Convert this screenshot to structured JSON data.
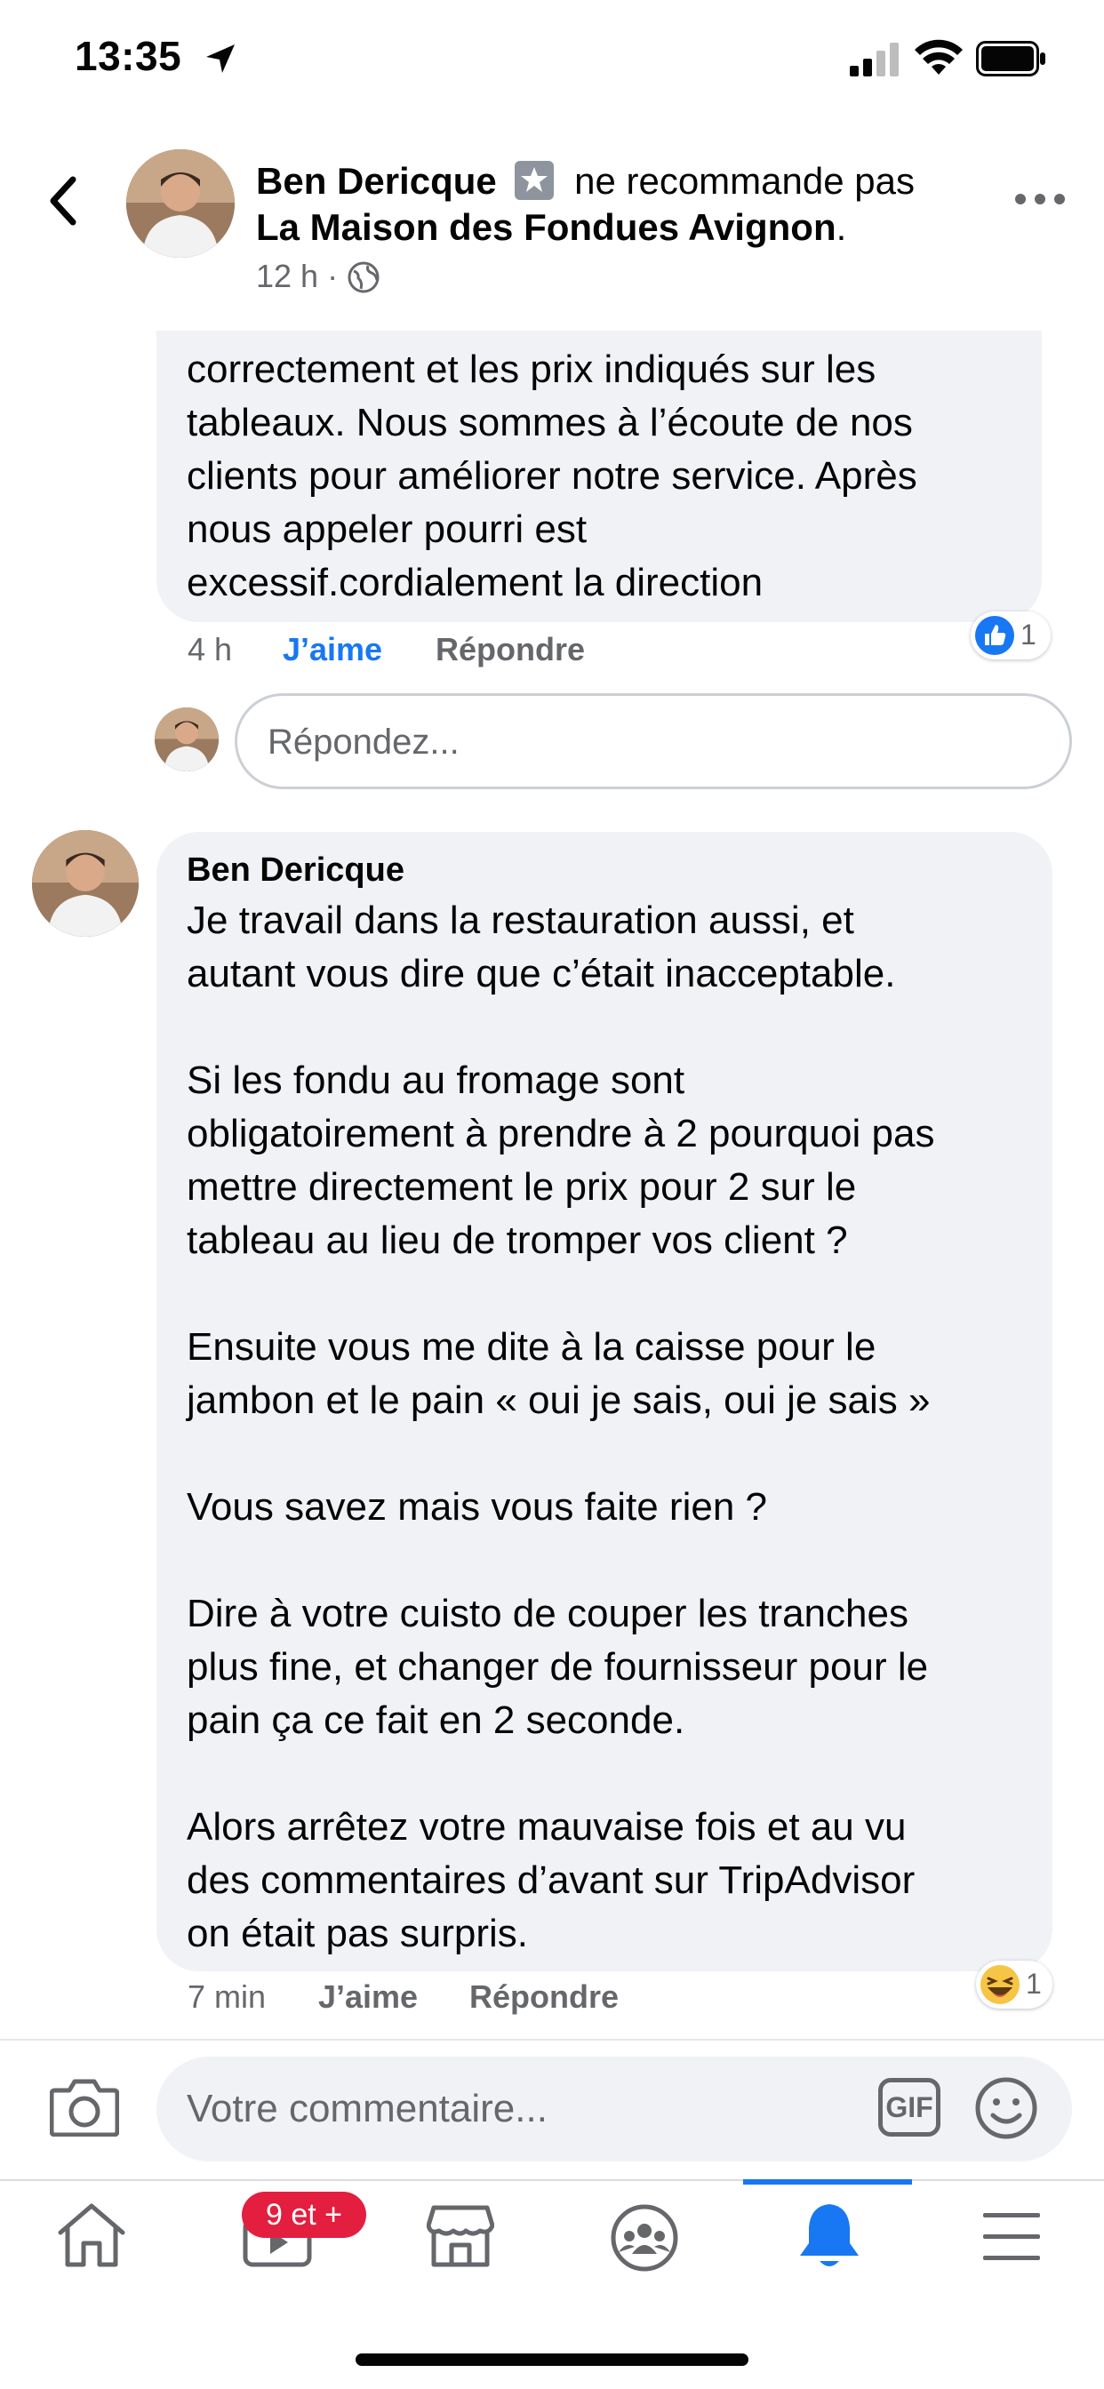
{
  "status_bar": {
    "time": "13:35"
  },
  "header": {
    "author": "Ben Dericque",
    "action": "ne recommande pas",
    "page": "La Maison des Fondues Avignon",
    "time": "12 h",
    "privacy_icon": "globe-icon"
  },
  "comment1": {
    "text": "correctement et les prix indiqués sur les\ntableaux. Nous sommes à l’écoute de nos\nclients pour améliorer notre service. Après\nnous appeler pourri est\nexcessif.cordialement la direction",
    "time": "4 h",
    "like_label": "J’aime",
    "reply_label": "Répondre",
    "reaction_count": "1",
    "reaction_icon": "thumbs-up-icon"
  },
  "reply_box": {
    "placeholder": "Répondez..."
  },
  "comment2": {
    "author": "Ben Dericque",
    "text": "Je travail dans la restauration aussi, et\nautant vous dire que c’était inacceptable.\n\nSi les fondu au fromage sont\nobligatoirement à prendre à 2 pourquoi pas\nmettre directement le prix pour 2 sur le\ntableau au lieu de tromper vos client ?\n\nEnsuite vous me dite à la caisse pour le\njambon et le pain « oui je sais, oui je sais »\n\nVous savez mais vous faite rien ?\n\nDire à votre cuisto de couper les tranches\nplus fine, et changer de fournisseur pour le\npain ça ce fait en 2 seconde.\n\nAlors arrêtez votre mauvaise fois et au vu\ndes commentaires d’avant sur TripAdvisor\non était pas surpris.",
    "time": "7 min",
    "like_label": "J’aime",
    "reply_label": "Répondre",
    "reaction_count": "1",
    "reaction_icon": "laughing-emoji-icon"
  },
  "composer": {
    "placeholder": "Votre commentaire...",
    "gif_label": "GIF"
  },
  "nav": {
    "items": [
      "home",
      "watch",
      "marketplace",
      "groups",
      "notifications",
      "menu"
    ],
    "watch_badge": "9 et +",
    "active": "notifications",
    "accent": "#1877f2"
  },
  "colors": {
    "brand": "#1877f2",
    "bubble": "#f0f2f5",
    "secondary_text": "#65676b",
    "badge": "#e41e3f"
  }
}
